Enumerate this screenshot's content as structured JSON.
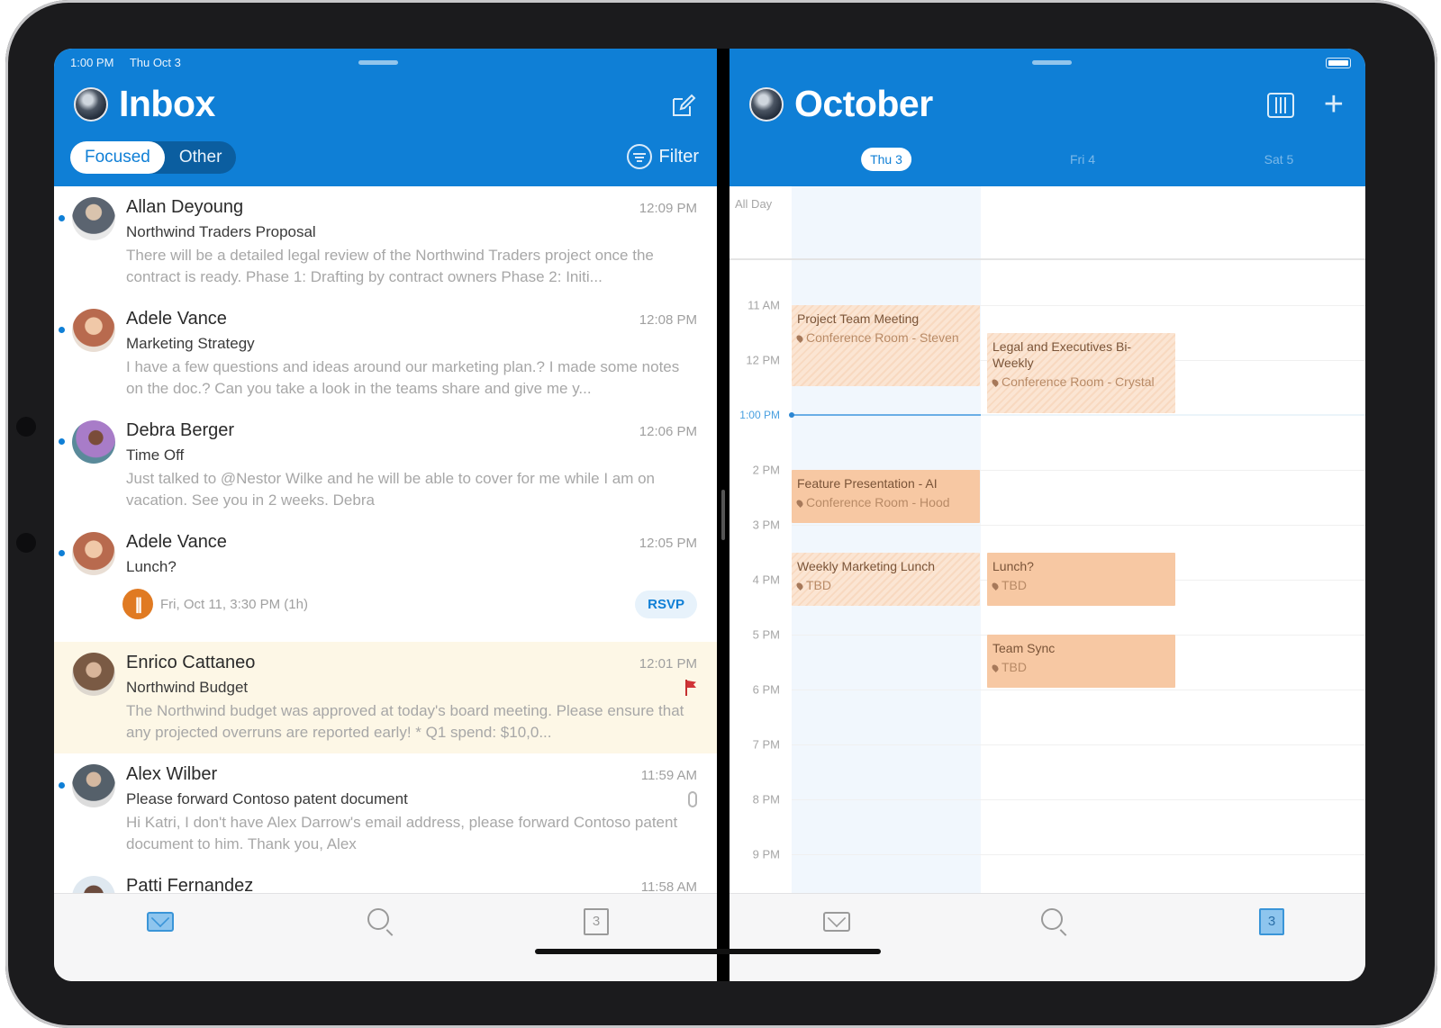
{
  "status_bar": {
    "time": "1:00 PM",
    "date": "Thu Oct 3"
  },
  "mail": {
    "title": "Inbox",
    "segments": [
      {
        "label": "Focused",
        "active": true
      },
      {
        "label": "Other",
        "active": false
      }
    ],
    "filter_label": "Filter",
    "messages": [
      {
        "sender": "Allan Deyoung",
        "time": "12:09 PM",
        "subject": "Northwind Traders Proposal",
        "preview": "There will be a detailed legal review of the Northwind Traders project once the contract is ready. Phase 1: Drafting by contract owners Phase 2: Initi...",
        "unread": true,
        "avatar_color": "#5b6470"
      },
      {
        "sender": "Adele Vance",
        "time": "12:08 PM",
        "subject": "Marketing Strategy",
        "preview": "I have a few questions and ideas around our marketing plan.? I made some notes on the doc.? Can you take a look in the teams share and give me y...",
        "unread": true,
        "avatar_color": "#b86a4e"
      },
      {
        "sender": "Debra Berger",
        "time": "12:06 PM",
        "subject": "Time Off",
        "preview": "Just talked to @Nestor Wilke and he will be able to cover for me while I am on vacation. See you in 2 weeks. Debra",
        "unread": true,
        "avatar_color": "#6e5a9a"
      },
      {
        "sender": "Adele Vance",
        "time": "12:05 PM",
        "subject": "Lunch?",
        "unread": true,
        "avatar_color": "#b86a4e",
        "event": {
          "when": "Fri, Oct 11, 3:30 PM (1h)",
          "rsvp_label": "RSVP"
        }
      },
      {
        "sender": "Enrico Cattaneo",
        "time": "12:01 PM",
        "subject": "Northwind Budget",
        "preview": "The Northwind budget was approved at today's board meeting. Please ensure that any projected overruns are reported early! * Q1 spend: $10,0...",
        "unread": false,
        "flagged": true,
        "avatar_color": "#7a5a44"
      },
      {
        "sender": "Alex Wilber",
        "time": "11:59 AM",
        "subject": "Please forward Contoso patent document",
        "preview": "Hi Katri, I don't have Alex Darrow's email address, please forward Contoso patent document to him. Thank you, Alex",
        "unread": true,
        "attachment": true,
        "avatar_color": "#55606a"
      },
      {
        "sender": "Patti Fernandez",
        "time": "11:58 AM",
        "unread": false,
        "avatar_color": "#6b4b3e"
      }
    ]
  },
  "calendar": {
    "title": "October",
    "days": [
      {
        "label": "Thu 3",
        "active": true
      },
      {
        "label": "Fri 4",
        "active": false
      },
      {
        "label": "Sat 5",
        "active": false
      }
    ],
    "all_day_label": "All Day",
    "hours": [
      "11 AM",
      "12 PM",
      "1:00 PM",
      "2 PM",
      "3 PM",
      "4 PM",
      "5 PM",
      "6 PM",
      "7 PM",
      "8 PM",
      "9 PM"
    ],
    "now_label": "1:00 PM",
    "events": [
      {
        "title": "Project Team Meeting",
        "location": "Conference Room - Steven",
        "day": 0,
        "start": 11.0,
        "end": 12.5,
        "style": "tentative"
      },
      {
        "title": "Legal and Executives Bi-Weekly",
        "location": "Conference Room - Crystal",
        "day": 1,
        "start": 11.5,
        "end": 13.0,
        "style": "tentative"
      },
      {
        "title": "Feature Presentation - AI",
        "location": "Conference Room - Hood",
        "day": 0,
        "start": 14.0,
        "end": 15.0,
        "style": "solid"
      },
      {
        "title": "Weekly Marketing Lunch",
        "location": "TBD",
        "day": 0,
        "start": 15.5,
        "end": 16.5,
        "style": "tentative"
      },
      {
        "title": "Lunch?",
        "location": "TBD",
        "day": 1,
        "start": 15.5,
        "end": 16.5,
        "style": "solid"
      },
      {
        "title": "Team Sync",
        "location": "TBD",
        "day": 1,
        "start": 17.0,
        "end": 18.0,
        "style": "solid"
      }
    ]
  },
  "tabbar": {
    "items": [
      {
        "name": "mail",
        "icon": "mail-icon"
      },
      {
        "name": "search",
        "icon": "search-icon"
      },
      {
        "name": "calendar",
        "icon": "calendar-icon",
        "day": "3"
      }
    ]
  },
  "colors": {
    "accent": "#0f7fd6",
    "event_solid": "#f7c8a3",
    "event_tentative": "#fbe5d3",
    "flag": "#d13438",
    "highlight_row": "#fdf7e6"
  }
}
